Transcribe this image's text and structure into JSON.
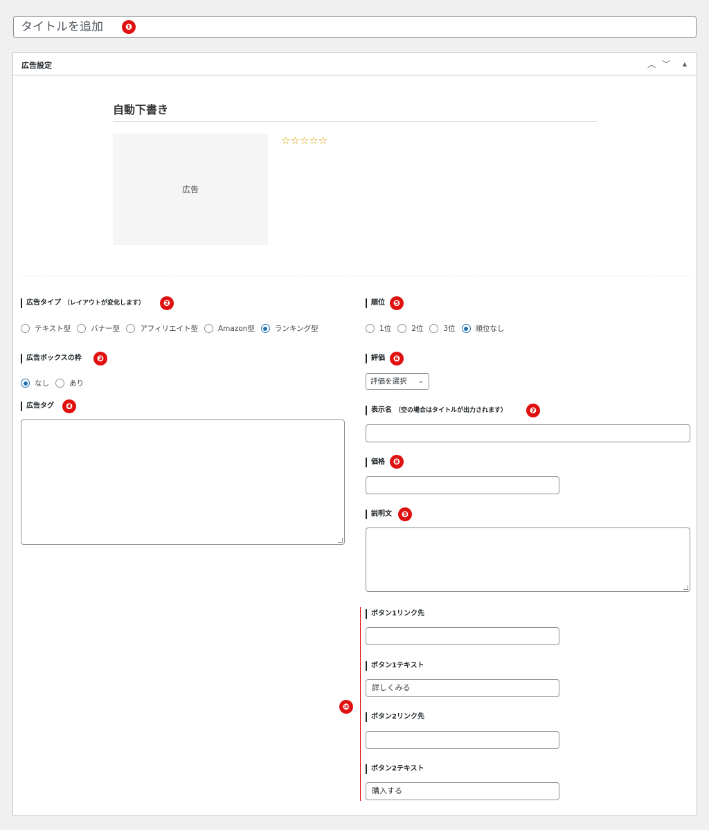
{
  "title_input": {
    "placeholder": "タイトルを追加"
  },
  "panel": {
    "title": "広告設定",
    "icons": {
      "up": "chevron-up-icon",
      "down": "chevron-down-icon",
      "toggle": "triangle-up-icon"
    }
  },
  "preview": {
    "title": "自動下書き",
    "ad_label": "広告",
    "stars": "☆☆☆☆☆"
  },
  "markers": [
    "❶",
    "❷",
    "❸",
    "❹",
    "❺",
    "❻",
    "❼",
    "❽",
    "❾",
    "❿"
  ],
  "ad_type": {
    "label": "広告タイプ",
    "note": "（レイアウトが変化します）",
    "options": [
      "テキスト型",
      "バナー型",
      "アフィリエイト型",
      "Amazon型",
      "ランキング型"
    ],
    "selected": "ランキング型"
  },
  "ad_box_border": {
    "label": "広告ボックスの枠",
    "options": [
      "なし",
      "あり"
    ],
    "selected": "なし"
  },
  "ad_tag": {
    "label": "広告タグ",
    "value": ""
  },
  "rank": {
    "label": "順位",
    "options": [
      "1位",
      "2位",
      "3位",
      "順位なし"
    ],
    "selected": "順位なし"
  },
  "rating": {
    "label": "評価",
    "selected": "評価を選択"
  },
  "display_name": {
    "label": "表示名",
    "note": "（空の場合はタイトルが出力されます）",
    "value": ""
  },
  "price": {
    "label": "価格",
    "value": ""
  },
  "description": {
    "label": "説明文",
    "value": ""
  },
  "buttons": {
    "btn1_link": {
      "label": "ボタン1リンク先",
      "value": ""
    },
    "btn1_text": {
      "label": "ボタン1テキスト",
      "value": "詳しくみる"
    },
    "btn2_link": {
      "label": "ボタン2リンク先",
      "value": ""
    },
    "btn2_text": {
      "label": "ボタン2テキスト",
      "value": "購入する"
    }
  },
  "colors": {
    "marker": "#e01010",
    "accent": "#2271b1",
    "stars": "#d4a000"
  }
}
